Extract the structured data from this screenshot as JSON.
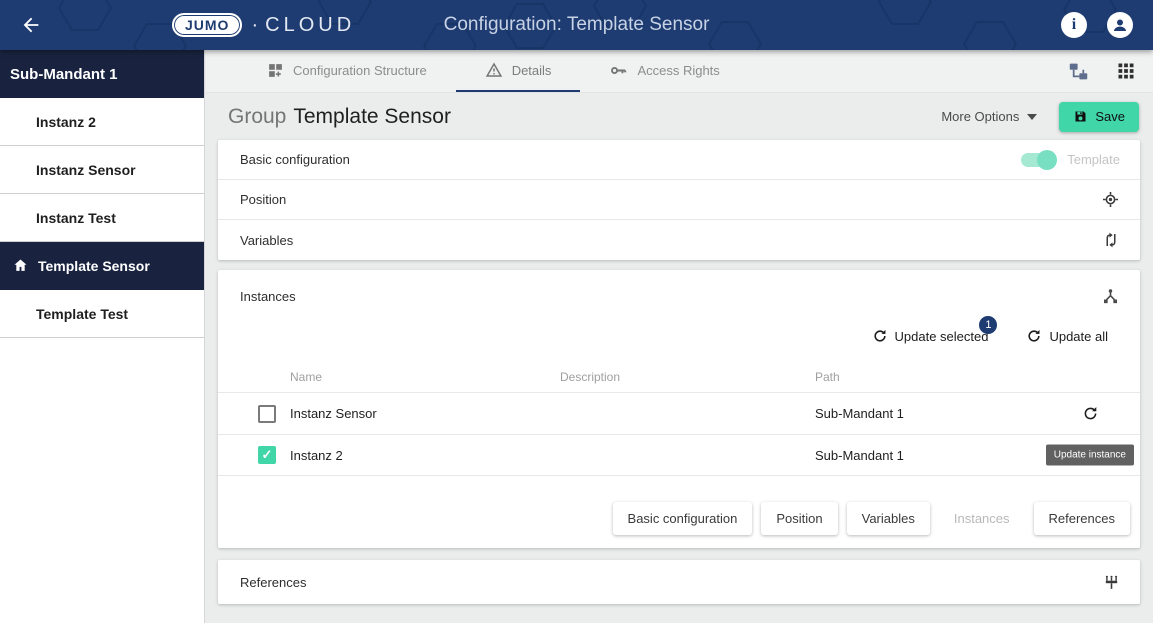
{
  "colors": {
    "header_blue": "#1e3c72",
    "sidebar_navy": "#19233f",
    "accent_teal": "#41d6a7",
    "badge_navy": "#1e3c72",
    "tooltip_gray": "#616161"
  },
  "topbar": {
    "logo_primary": "JUMO",
    "logo_separator": "·",
    "logo_secondary": "CLOUD",
    "title": "Configuration: Template Sensor",
    "info_glyph": "i"
  },
  "sidebar": {
    "header": "Sub-Mandant 1",
    "items": [
      {
        "label": "Instanz 2",
        "selected": false
      },
      {
        "label": "Instanz Sensor",
        "selected": false
      },
      {
        "label": "Instanz Test",
        "selected": false
      },
      {
        "label": "Template Sensor",
        "selected": true
      },
      {
        "label": "Template Test",
        "selected": false
      }
    ]
  },
  "toolbar": {
    "tabs": [
      {
        "label": "Configuration Structure",
        "icon": "grid-plus-icon",
        "active": false
      },
      {
        "label": "Details",
        "icon": "warning-triangle-icon",
        "active": true
      },
      {
        "label": "Access Rights",
        "icon": "key-icon",
        "active": false
      }
    ],
    "right_icons": [
      "tree-view-icon",
      "apps-grid-icon"
    ]
  },
  "page_header": {
    "type_label": "Group",
    "name": "Template Sensor",
    "more_options_label": "More Options",
    "save_label": "Save"
  },
  "sections": {
    "basic_configuration": {
      "label": "Basic configuration",
      "toggle_label": "Template",
      "toggle_on": true
    },
    "position": {
      "label": "Position",
      "icon": "gps-fixed-icon"
    },
    "variables": {
      "label": "Variables",
      "icon": "swap-curves-icon"
    }
  },
  "instances": {
    "label": "Instances",
    "icon": "device-hub-icon",
    "update_selected_label": "Update selected",
    "update_selected_badge": "1",
    "update_all_label": "Update all",
    "columns": {
      "name": "Name",
      "description": "Description",
      "path": "Path"
    },
    "rows": [
      {
        "name": "Instanz Sensor",
        "description": "",
        "path": "Sub-Mandant 1",
        "checked": false
      },
      {
        "name": "Instanz 2",
        "description": "",
        "path": "Sub-Mandant 1",
        "checked": true
      }
    ],
    "row_tooltip": "Update instance",
    "footer_buttons": [
      {
        "label": "Basic configuration",
        "enabled": true
      },
      {
        "label": "Position",
        "enabled": true
      },
      {
        "label": "Variables",
        "enabled": true
      },
      {
        "label": "Instances",
        "enabled": false
      },
      {
        "label": "References",
        "enabled": true
      }
    ]
  },
  "references": {
    "label": "References",
    "icon": "input-composite-icon"
  }
}
